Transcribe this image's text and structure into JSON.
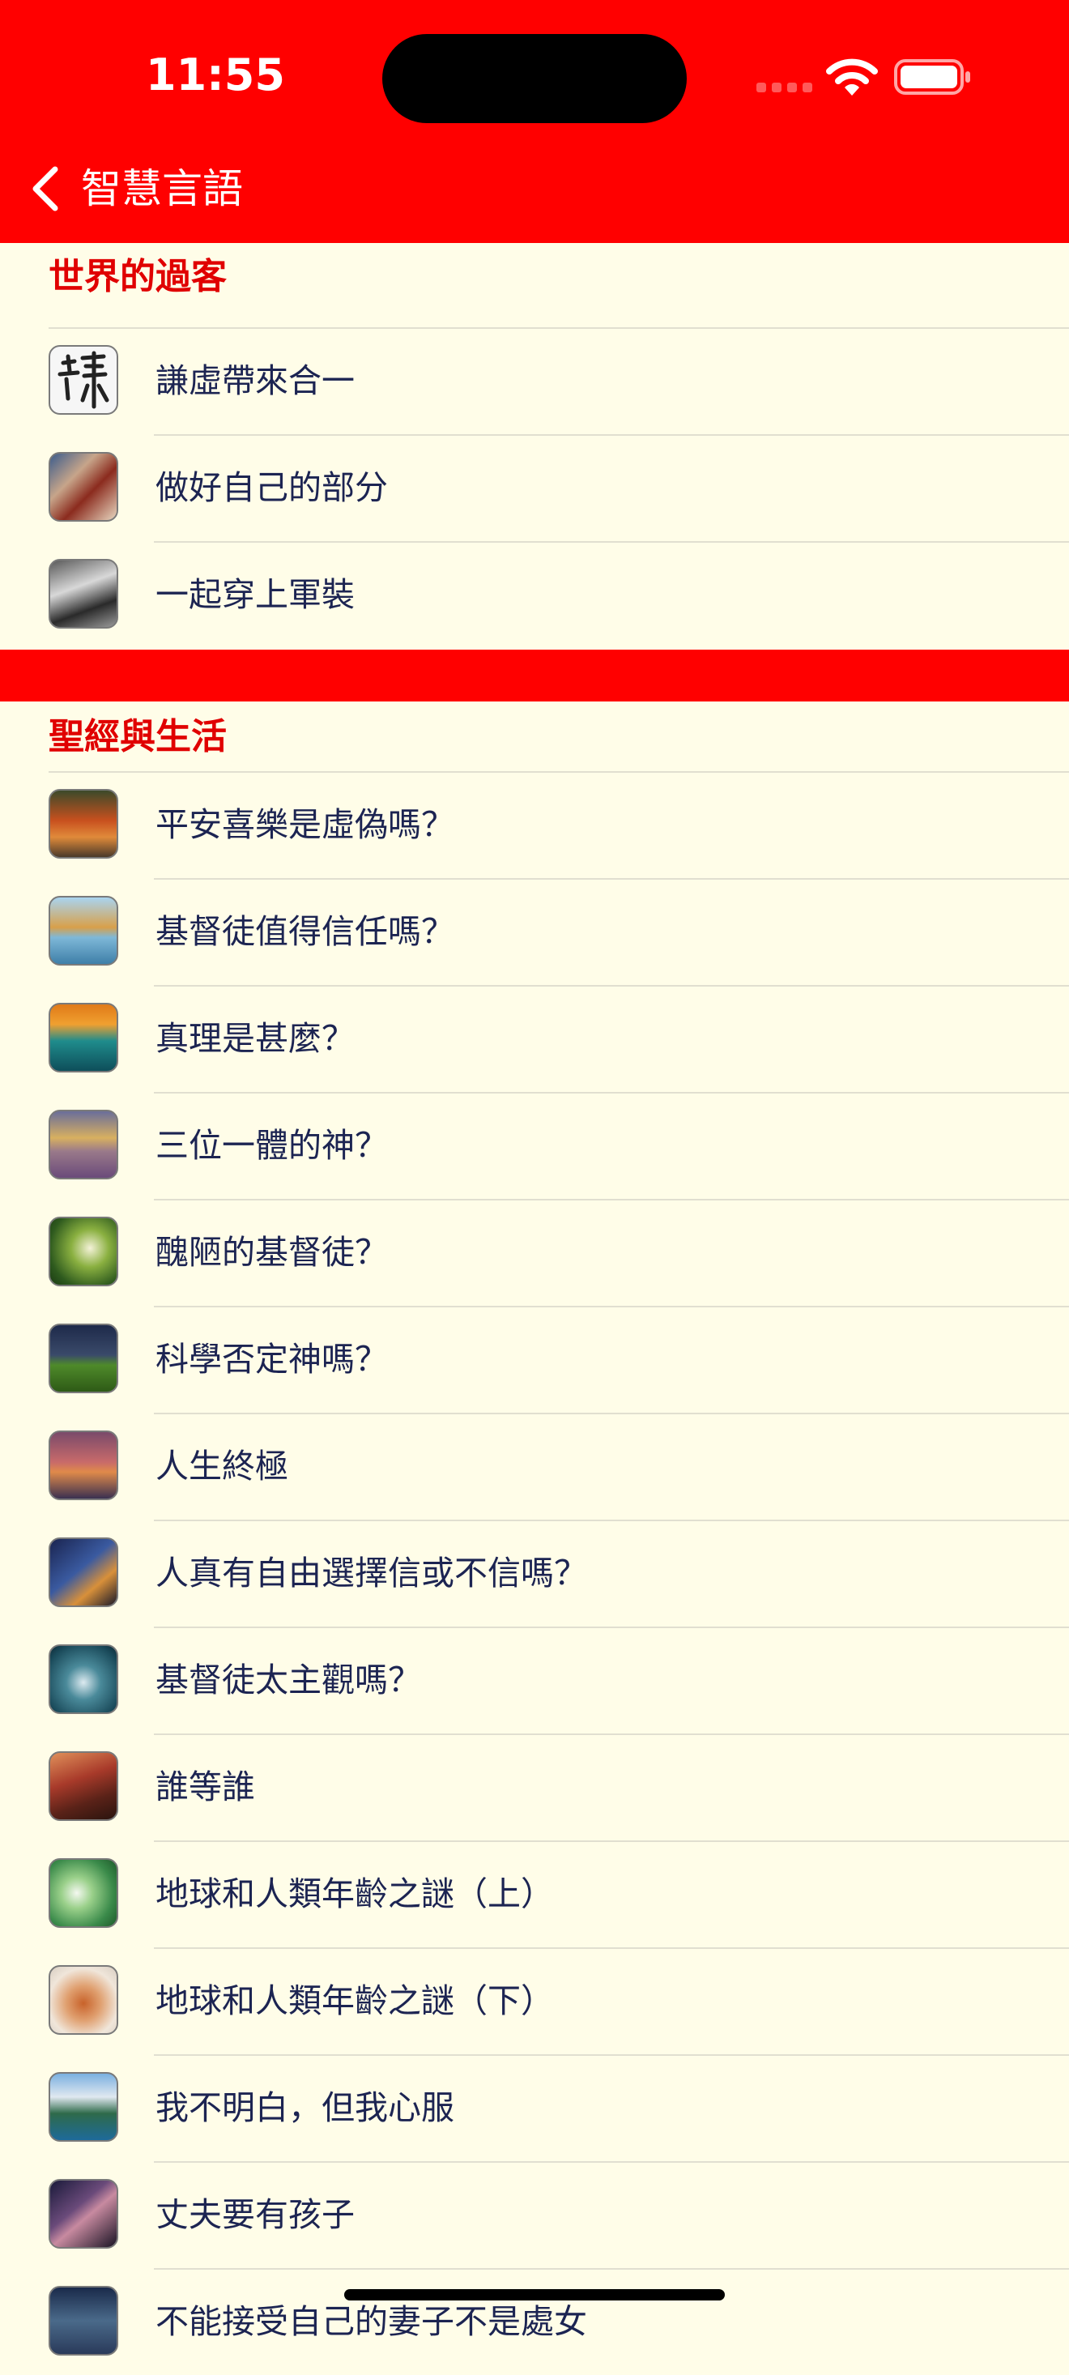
{
  "status_bar": {
    "time": "11:55"
  },
  "nav_bar": {
    "title": "智慧言語"
  },
  "sections": [
    {
      "header": "世界的過客",
      "items": [
        {
          "label": "謙虛帶來合一",
          "thumb": "calligraphy-thumbnail"
        },
        {
          "label": "做好自己的部分",
          "thumb": "people-thumbnail"
        },
        {
          "label": "一起穿上軍裝",
          "thumb": "soldier-thumbnail"
        }
      ]
    },
    {
      "header": "聖經與生活",
      "items": [
        {
          "label": "平安喜樂是虛偽嗎？",
          "thumb": "autumn-road-thumbnail"
        },
        {
          "label": "基督徒值得信任嗎？",
          "thumb": "lake-reflection-thumbnail"
        },
        {
          "label": "真理是甚麼？",
          "thumb": "teal-tree-thumbnail"
        },
        {
          "label": "三位一體的神？",
          "thumb": "mountain-field-thumbnail"
        },
        {
          "label": "醜陋的基督徒？",
          "thumb": "butterfly-thumbnail"
        },
        {
          "label": "科學否定神嗎？",
          "thumb": "green-hill-thumbnail"
        },
        {
          "label": "人生終極",
          "thumb": "sunset-sea-thumbnail"
        },
        {
          "label": "人真有自由選擇信或不信嗎？",
          "thumb": "night-sky-thumbnail"
        },
        {
          "label": "基督徒太主觀嗎？",
          "thumb": "water-drop-thumbnail"
        },
        {
          "label": "誰等誰",
          "thumb": "forest-path-thumbnail"
        },
        {
          "label": "地球和人類年齡之謎（上）",
          "thumb": "white-flower-thumbnail"
        },
        {
          "label": "地球和人類年齡之謎（下）",
          "thumb": "fox-thumbnail"
        },
        {
          "label": "我不明白，但我心服",
          "thumb": "mountain-lake-thumbnail"
        },
        {
          "label": "丈夫要有孩子",
          "thumb": "milky-way-thumbnail"
        },
        {
          "label": "不能接受自己的妻子不是處女",
          "thumb": "dark-sky-thumbnail"
        }
      ]
    }
  ],
  "colors": {
    "brand_red": "#FF0000",
    "section_header_red": "#E00000",
    "background": "#FFFDE8",
    "item_text": "#1C2452"
  }
}
